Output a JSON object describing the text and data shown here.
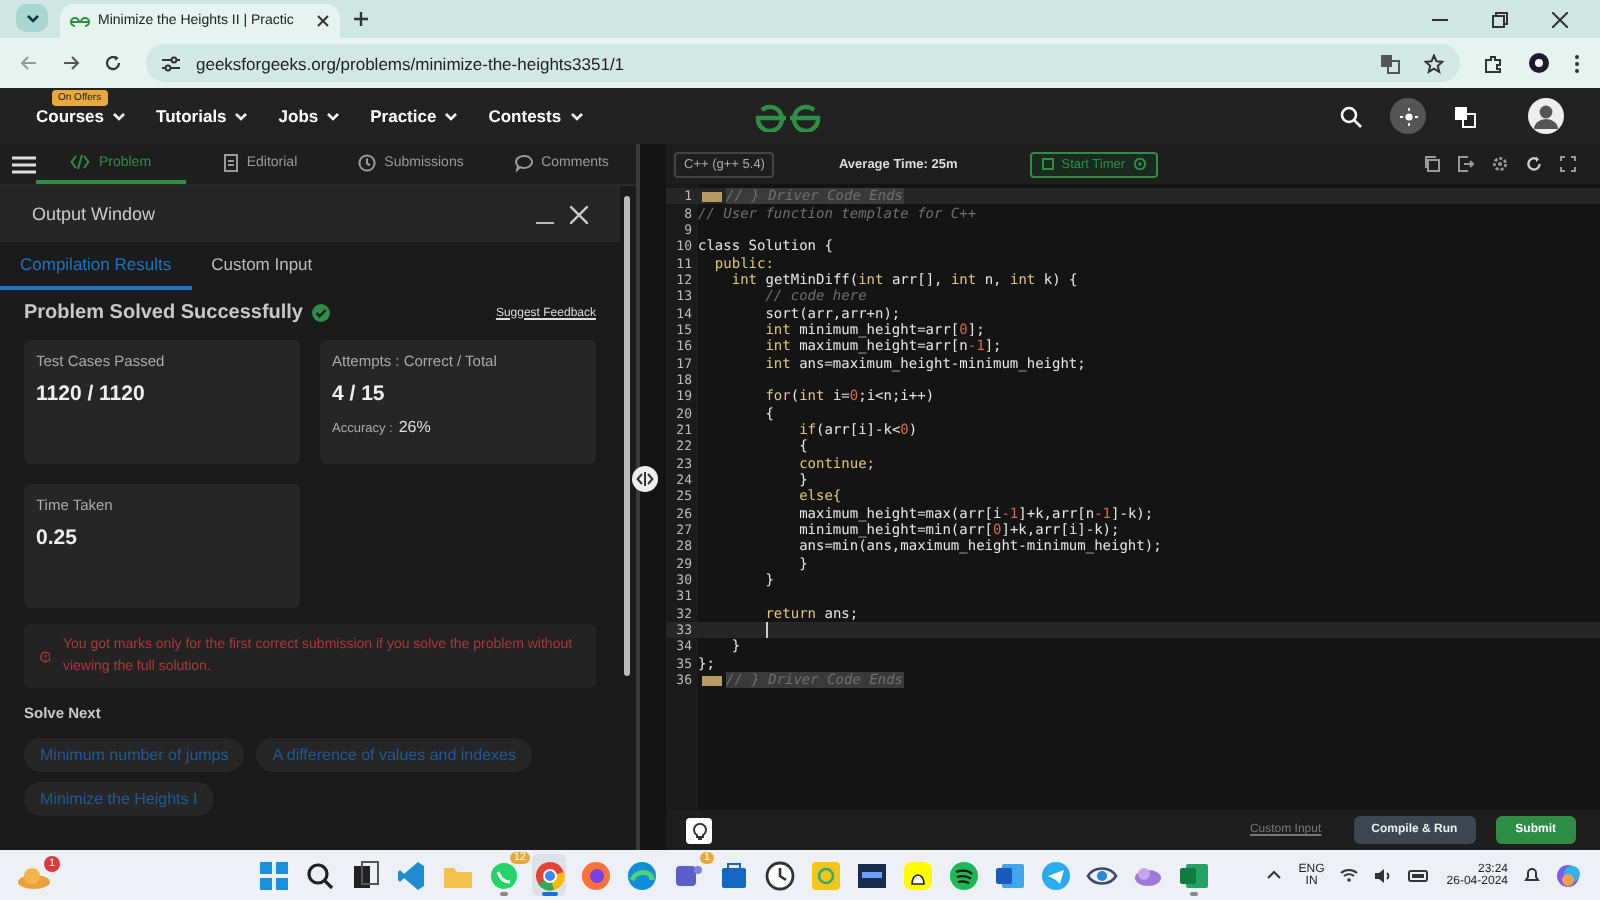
{
  "browser": {
    "tab_title": "Minimize the Heights II | Practic",
    "url": "geeksforgeeks.org/problems/minimize-the-heights3351/1"
  },
  "site_nav": {
    "items": [
      {
        "label": "Courses",
        "badge": "On Offers"
      },
      {
        "label": "Tutorials"
      },
      {
        "label": "Jobs"
      },
      {
        "label": "Practice"
      },
      {
        "label": "Contests"
      }
    ]
  },
  "problem_tabs": [
    {
      "label": "Problem",
      "selected": true,
      "kind": "code"
    },
    {
      "label": "Editorial",
      "selected": false,
      "kind": "doc"
    },
    {
      "label": "Submissions",
      "selected": false,
      "kind": "clock"
    },
    {
      "label": "Comments",
      "selected": false,
      "kind": "bubble"
    }
  ],
  "output_window": {
    "title": "Output Window",
    "tabs": [
      {
        "label": "Compilation Results",
        "selected": true
      },
      {
        "label": "Custom Input",
        "selected": false
      }
    ],
    "status": "Problem Solved Successfully",
    "feedback_link": "Suggest Feedback",
    "cards": [
      {
        "label": "Test Cases Passed",
        "value": "1120 / 1120"
      },
      {
        "label": "Attempts : Correct / Total",
        "value": "4 / 15",
        "accuracy_label": "Accuracy :",
        "accuracy_value": "26%"
      },
      {
        "label": "Time Taken",
        "value": "0.25"
      }
    ],
    "notice": "You got marks only for the first correct submission if you solve the problem without viewing the full solution.",
    "solve_next": {
      "title": "Solve Next",
      "problems": [
        "Minimum number of jumps",
        "A difference of values and indexes",
        "Minimize the Heights I"
      ]
    }
  },
  "editor": {
    "language": "C++ (g++ 5.4)",
    "average_time": "Average Time: 25m",
    "timer_button": "Start Timer",
    "lines": [
      {
        "number": "1",
        "kind": "folded",
        "active": true,
        "tokens": [
          {
            "text": "// } Driver Code Ends",
            "kind": "comment"
          }
        ]
      },
      {
        "number": "8",
        "kind": "code",
        "active": false,
        "tokens": [
          {
            "text": "// User function template for C++",
            "kind": "comment"
          }
        ]
      },
      {
        "number": "9",
        "kind": "code",
        "active": false
      },
      {
        "number": "10",
        "kind": "code",
        "active": false,
        "tokens": [
          {
            "text": "class Solution {",
            "kind": "plain"
          }
        ]
      },
      {
        "number": "11",
        "kind": "code",
        "active": false,
        "tokens": [
          {
            "text": "  public:",
            "kind": "keyword"
          }
        ]
      },
      {
        "number": "12",
        "kind": "code",
        "active": false,
        "tokens": [
          {
            "text": "    int",
            "kind": "keyword"
          },
          {
            "text": " getMinDiff(",
            "kind": "plain"
          },
          {
            "text": "int",
            "kind": "keyword"
          },
          {
            "text": " arr[], ",
            "kind": "plain"
          },
          {
            "text": "int",
            "kind": "keyword"
          },
          {
            "text": " n, ",
            "kind": "plain"
          },
          {
            "text": "int",
            "kind": "keyword"
          },
          {
            "text": " k) {",
            "kind": "plain"
          }
        ]
      },
      {
        "number": "13",
        "kind": "code",
        "active": false,
        "tokens": [
          {
            "text": "        // code here",
            "kind": "comment"
          }
        ]
      },
      {
        "number": "14",
        "kind": "code",
        "active": false,
        "tokens": [
          {
            "text": "        sort(arr,arr+n);",
            "kind": "plain"
          }
        ]
      },
      {
        "number": "15",
        "kind": "code",
        "active": false,
        "tokens": [
          {
            "text": "        int",
            "kind": "keyword"
          },
          {
            "text": " minimum_height=arr[",
            "kind": "plain"
          },
          {
            "text": "0",
            "kind": "number"
          },
          {
            "text": "];",
            "kind": "plain"
          }
        ]
      },
      {
        "number": "16",
        "kind": "code",
        "active": false,
        "tokens": [
          {
            "text": "        int",
            "kind": "keyword"
          },
          {
            "text": " maximum_height=arr[n",
            "kind": "plain"
          },
          {
            "text": "-1",
            "kind": "number"
          },
          {
            "text": "];",
            "kind": "plain"
          }
        ]
      },
      {
        "number": "17",
        "kind": "code",
        "active": false,
        "tokens": [
          {
            "text": "        int",
            "kind": "keyword"
          },
          {
            "text": " ans=maximum_height-minimum_height;",
            "kind": "plain"
          }
        ]
      },
      {
        "number": "18",
        "kind": "code",
        "active": false
      },
      {
        "number": "19",
        "kind": "code",
        "active": false,
        "tokens": [
          {
            "text": "        for",
            "kind": "keyword"
          },
          {
            "text": "(",
            "kind": "plain"
          },
          {
            "text": "int",
            "kind": "keyword"
          },
          {
            "text": " i=",
            "kind": "plain"
          },
          {
            "text": "0",
            "kind": "number"
          },
          {
            "text": ";i<n;i++)",
            "kind": "plain"
          }
        ]
      },
      {
        "number": "20",
        "kind": "code",
        "active": false,
        "tokens": [
          {
            "text": "        {",
            "kind": "plain"
          }
        ]
      },
      {
        "number": "21",
        "kind": "code",
        "active": false,
        "tokens": [
          {
            "text": "            if",
            "kind": "keyword"
          },
          {
            "text": "(arr[i]-k<",
            "kind": "plain"
          },
          {
            "text": "0",
            "kind": "number"
          },
          {
            "text": ")",
            "kind": "plain"
          }
        ]
      },
      {
        "number": "22",
        "kind": "code",
        "active": false,
        "tokens": [
          {
            "text": "            {",
            "kind": "plain"
          }
        ]
      },
      {
        "number": "23",
        "kind": "code",
        "active": false,
        "tokens": [
          {
            "text": "            continue;",
            "kind": "keyword"
          }
        ]
      },
      {
        "number": "24",
        "kind": "code",
        "active": false,
        "tokens": [
          {
            "text": "            }",
            "kind": "plain"
          }
        ]
      },
      {
        "number": "25",
        "kind": "code",
        "active": false,
        "tokens": [
          {
            "text": "            else{",
            "kind": "keyword"
          }
        ]
      },
      {
        "number": "26",
        "kind": "code",
        "active": false,
        "tokens": [
          {
            "text": "            maximum_height=max(arr[i",
            "kind": "plain"
          },
          {
            "text": "-1",
            "kind": "number"
          },
          {
            "text": "]+k,arr[n",
            "kind": "plain"
          },
          {
            "text": "-1",
            "kind": "number"
          },
          {
            "text": "]-k);",
            "kind": "plain"
          }
        ]
      },
      {
        "number": "27",
        "kind": "code",
        "active": false,
        "tokens": [
          {
            "text": "            minimum_height=min(arr[",
            "kind": "plain"
          },
          {
            "text": "0",
            "kind": "number"
          },
          {
            "text": "]+k,arr[i]-k);",
            "kind": "plain"
          }
        ]
      },
      {
        "number": "28",
        "kind": "code",
        "active": false,
        "tokens": [
          {
            "text": "            ans=min(ans,maximum_height-minimum_height);",
            "kind": "plain"
          }
        ]
      },
      {
        "number": "29",
        "kind": "code",
        "active": false,
        "tokens": [
          {
            "text": "            }",
            "kind": "plain"
          }
        ]
      },
      {
        "number": "30",
        "kind": "code",
        "active": false,
        "tokens": [
          {
            "text": "        }",
            "kind": "plain"
          }
        ]
      },
      {
        "number": "31",
        "kind": "code",
        "active": false
      },
      {
        "number": "32",
        "kind": "code",
        "active": false,
        "tokens": [
          {
            "text": "        return",
            "kind": "keyword"
          },
          {
            "text": " ans;",
            "kind": "plain"
          }
        ]
      },
      {
        "number": "33",
        "kind": "code",
        "active": true
      },
      {
        "number": "34",
        "kind": "code",
        "active": false,
        "tokens": [
          {
            "text": "    }",
            "kind": "plain"
          }
        ]
      },
      {
        "number": "35",
        "kind": "code",
        "active": false,
        "tokens": [
          {
            "text": "};",
            "kind": "plain"
          }
        ]
      },
      {
        "number": "36",
        "kind": "folded",
        "active": false,
        "tokens": [
          {
            "text": "// } Driver Code Ends",
            "kind": "comment"
          }
        ]
      }
    ],
    "custom_input_link": "Custom Input",
    "compile_button": "Compile & Run",
    "submit_button": "Submit"
  },
  "taskbar": {
    "weather_badge": "1",
    "apps": [
      {
        "kind": "windows",
        "running": false,
        "active": false
      },
      {
        "kind": "search",
        "running": false,
        "active": false
      },
      {
        "kind": "taskview",
        "running": false,
        "active": false
      },
      {
        "kind": "vscode",
        "running": false,
        "active": false
      },
      {
        "kind": "folder",
        "running": false,
        "active": false
      },
      {
        "kind": "whatsapp",
        "running": true,
        "active": false,
        "badge": "12"
      },
      {
        "kind": "chrome",
        "running": true,
        "active": true
      },
      {
        "kind": "firefox",
        "running": false,
        "active": false
      },
      {
        "kind": "edge",
        "running": false,
        "active": false
      },
      {
        "kind": "teams",
        "running": false,
        "active": false,
        "badge": "1"
      },
      {
        "kind": "store",
        "running": false,
        "active": false
      },
      {
        "kind": "clock",
        "running": false,
        "active": false
      },
      {
        "kind": "sticky",
        "running": false,
        "active": false
      },
      {
        "kind": "dev",
        "running": false,
        "active": false
      },
      {
        "kind": "snapchat",
        "running": false,
        "active": false
      },
      {
        "kind": "spotify",
        "running": false,
        "active": false
      },
      {
        "kind": "word",
        "running": false,
        "active": false
      },
      {
        "kind": "telegram",
        "running": false,
        "active": false
      },
      {
        "kind": "eye",
        "running": false,
        "active": false
      },
      {
        "kind": "cloud",
        "running": false,
        "active": false
      },
      {
        "kind": "excel",
        "running": true,
        "active": false
      }
    ],
    "language": "ENG",
    "region": "IN",
    "time": "23:24",
    "date": "26-04-2024"
  }
}
